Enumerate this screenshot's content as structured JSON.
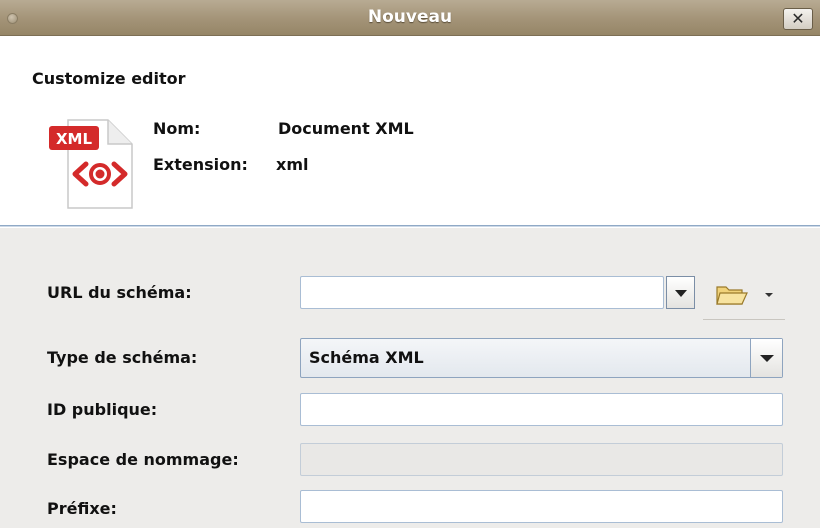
{
  "window": {
    "title": "Nouveau",
    "close_glyph": "✕"
  },
  "header": {
    "title": "Customize editor",
    "icon": {
      "name": "xml-file-icon",
      "badge": "XML",
      "glyph": "⟨●⟩"
    },
    "name_label": "Nom:",
    "name_value": "Document XML",
    "extension_label": "Extension:",
    "extension_value": "xml"
  },
  "form": {
    "schema_url": {
      "label": "URL du schéma:",
      "value": ""
    },
    "schema_type": {
      "label": "Type de schéma:",
      "value": "Schéma XML"
    },
    "public_id": {
      "label": "ID publique:",
      "value": ""
    },
    "namespace": {
      "label": "Espace de nommage:",
      "value": ""
    },
    "prefix": {
      "label": "Préfixe:",
      "value": ""
    }
  },
  "colors": {
    "titlebar": "#a39377",
    "accent_border": "#8fa9c6",
    "badge_red": "#d42a2a",
    "form_background": "#edecea"
  }
}
